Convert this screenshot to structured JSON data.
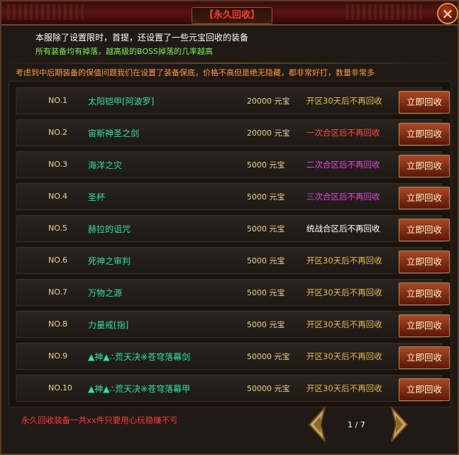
{
  "window": {
    "title": "【永久回收】",
    "close_symbol": "✕"
  },
  "notices": {
    "line1": "本服除了设置限时，首提，还设置了一些元宝回收的装备",
    "line2": "所有装备均有掉落，越高级的BOSS掉落的几率越高",
    "line3": "考虑到中后期装备的保值问题我们在设置了装备保底，价格不高但是绝无隐藏，都非常好打，数量非常多"
  },
  "colors": {
    "cond_orange": "#e6b84a",
    "cond_red": "#ff4a3a",
    "cond_magenta": "#e04adf",
    "cond_white": "#ffffff"
  },
  "rows": [
    {
      "num": "NO.1",
      "name": "太阳铠甲[阿波罗]",
      "price": "20000 元宝",
      "cond": "开区30天后不再回收",
      "cond_color": "#e6b84a",
      "button": "立即回收"
    },
    {
      "num": "NO.2",
      "name": "宙斯神圣之剑",
      "price": "20000 元宝",
      "cond": "一次合区后不再回收",
      "cond_color": "#ff4a3a",
      "button": "立即回收"
    },
    {
      "num": "NO.3",
      "name": "海洋之灾",
      "price": "5000 元宝",
      "cond": "二次合区后不再回收",
      "cond_color": "#e04adf",
      "button": "立即回收"
    },
    {
      "num": "NO.4",
      "name": "圣杯",
      "price": "5000 元宝",
      "cond": "三次合区后不再回收",
      "cond_color": "#e04adf",
      "button": "立即回收"
    },
    {
      "num": "NO.5",
      "name": "赫拉的诅咒",
      "price": "5000 元宝",
      "cond": "统战合区后不再回收",
      "cond_color": "#ffffff",
      "button": "立即回收"
    },
    {
      "num": "NO.6",
      "name": "死神之审判",
      "price": "5000 元宝",
      "cond": "开区30天后不再回收",
      "cond_color": "#e6b84a",
      "button": "立即回收"
    },
    {
      "num": "NO.7",
      "name": "万物之源",
      "price": "5000 元宝",
      "cond": "开区30天后不再回收",
      "cond_color": "#e6b84a",
      "button": "立即回收"
    },
    {
      "num": "NO.8",
      "name": "力量戒[指]",
      "price": "5000 元宝",
      "cond": "开区30天后不再回收",
      "cond_color": "#e6b84a",
      "button": "立即回收"
    },
    {
      "num": "NO.9",
      "name": "▲神▲∴荒天决※苍穹落幕剑",
      "price": "50000 元宝",
      "cond": "开区30天后不再回收",
      "cond_color": "#e6b84a",
      "button": "立即回收"
    },
    {
      "num": "NO.10",
      "name": "▲神▲∴荒天决※苍穹落幕甲",
      "price": "50000 元宝",
      "cond": "开区30天后不再回收",
      "cond_color": "#e6b84a",
      "button": "立即回收"
    }
  ],
  "footer": {
    "note": "永久回收装备一共xx件只要用心玩稳赚不亏",
    "page_indicator": "1 / 7"
  }
}
